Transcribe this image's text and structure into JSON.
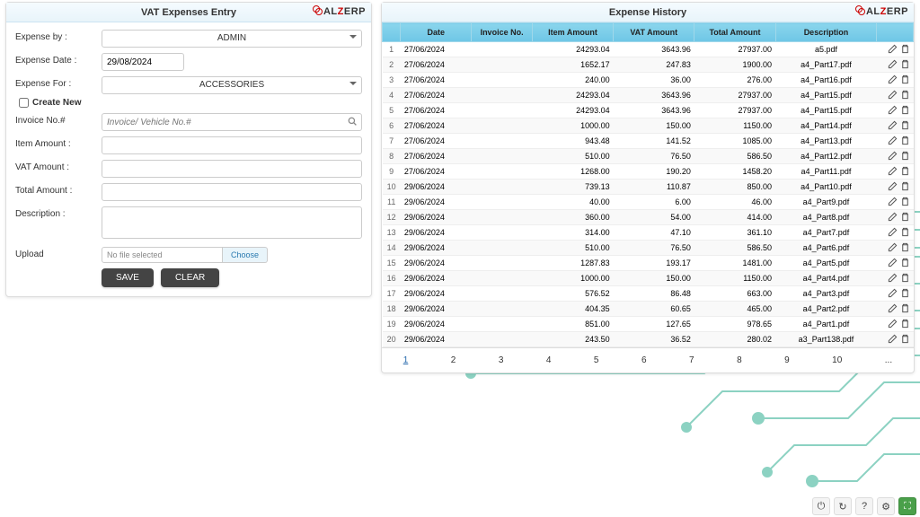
{
  "brand": "ALZERP",
  "left_panel": {
    "title": "VAT Expenses Entry",
    "labels": {
      "expense_by": "Expense by :",
      "expense_date": "Expense Date :",
      "expense_for": "Expense For :",
      "create_new": "Create New",
      "invoice_no": "Invoice No.#",
      "item_amount": "Item Amount :",
      "vat_amount": "VAT Amount :",
      "total_amount": "Total Amount :",
      "description": "Description :",
      "upload": "Upload"
    },
    "values": {
      "expense_by": "ADMIN",
      "expense_date": "29/08/2024",
      "expense_for": "ACCESSORIES",
      "invoice_placeholder": "Invoice/ Vehicle No.#",
      "file_text": "No file selected",
      "file_btn": "Choose"
    },
    "buttons": {
      "save": "SAVE",
      "clear": "CLEAR"
    }
  },
  "right_panel": {
    "title": "Expense History",
    "columns": [
      "Date",
      "Invoice No.",
      "Item Amount",
      "VAT Amount",
      "Total Amount",
      "Description"
    ],
    "rows": [
      {
        "n": "1",
        "date": "27/06/2024",
        "inv": "",
        "item": "24293.04",
        "vat": "3643.96",
        "tot": "27937.00",
        "desc": "a5.pdf"
      },
      {
        "n": "2",
        "date": "27/06/2024",
        "inv": "",
        "item": "1652.17",
        "vat": "247.83",
        "tot": "1900.00",
        "desc": "a4_Part17.pdf"
      },
      {
        "n": "3",
        "date": "27/06/2024",
        "inv": "",
        "item": "240.00",
        "vat": "36.00",
        "tot": "276.00",
        "desc": "a4_Part16.pdf"
      },
      {
        "n": "4",
        "date": "27/06/2024",
        "inv": "",
        "item": "24293.04",
        "vat": "3643.96",
        "tot": "27937.00",
        "desc": "a4_Part15.pdf"
      },
      {
        "n": "5",
        "date": "27/06/2024",
        "inv": "",
        "item": "24293.04",
        "vat": "3643.96",
        "tot": "27937.00",
        "desc": "a4_Part15.pdf"
      },
      {
        "n": "6",
        "date": "27/06/2024",
        "inv": "",
        "item": "1000.00",
        "vat": "150.00",
        "tot": "1150.00",
        "desc": "a4_Part14.pdf"
      },
      {
        "n": "7",
        "date": "27/06/2024",
        "inv": "",
        "item": "943.48",
        "vat": "141.52",
        "tot": "1085.00",
        "desc": "a4_Part13.pdf"
      },
      {
        "n": "8",
        "date": "27/06/2024",
        "inv": "",
        "item": "510.00",
        "vat": "76.50",
        "tot": "586.50",
        "desc": "a4_Part12.pdf"
      },
      {
        "n": "9",
        "date": "27/06/2024",
        "inv": "",
        "item": "1268.00",
        "vat": "190.20",
        "tot": "1458.20",
        "desc": "a4_Part11.pdf"
      },
      {
        "n": "10",
        "date": "29/06/2024",
        "inv": "",
        "item": "739.13",
        "vat": "110.87",
        "tot": "850.00",
        "desc": "a4_Part10.pdf"
      },
      {
        "n": "11",
        "date": "29/06/2024",
        "inv": "",
        "item": "40.00",
        "vat": "6.00",
        "tot": "46.00",
        "desc": "a4_Part9.pdf"
      },
      {
        "n": "12",
        "date": "29/06/2024",
        "inv": "",
        "item": "360.00",
        "vat": "54.00",
        "tot": "414.00",
        "desc": "a4_Part8.pdf"
      },
      {
        "n": "13",
        "date": "29/06/2024",
        "inv": "",
        "item": "314.00",
        "vat": "47.10",
        "tot": "361.10",
        "desc": "a4_Part7.pdf"
      },
      {
        "n": "14",
        "date": "29/06/2024",
        "inv": "",
        "item": "510.00",
        "vat": "76.50",
        "tot": "586.50",
        "desc": "a4_Part6.pdf"
      },
      {
        "n": "15",
        "date": "29/06/2024",
        "inv": "",
        "item": "1287.83",
        "vat": "193.17",
        "tot": "1481.00",
        "desc": "a4_Part5.pdf"
      },
      {
        "n": "16",
        "date": "29/06/2024",
        "inv": "",
        "item": "1000.00",
        "vat": "150.00",
        "tot": "1150.00",
        "desc": "a4_Part4.pdf"
      },
      {
        "n": "17",
        "date": "29/06/2024",
        "inv": "",
        "item": "576.52",
        "vat": "86.48",
        "tot": "663.00",
        "desc": "a4_Part3.pdf"
      },
      {
        "n": "18",
        "date": "29/06/2024",
        "inv": "",
        "item": "404.35",
        "vat": "60.65",
        "tot": "465.00",
        "desc": "a4_Part2.pdf"
      },
      {
        "n": "19",
        "date": "29/06/2024",
        "inv": "",
        "item": "851.00",
        "vat": "127.65",
        "tot": "978.65",
        "desc": "a4_Part1.pdf"
      },
      {
        "n": "20",
        "date": "29/06/2024",
        "inv": "",
        "item": "243.50",
        "vat": "36.52",
        "tot": "280.02",
        "desc": "a3_Part138.pdf"
      }
    ],
    "pages": [
      "1",
      "2",
      "3",
      "4",
      "5",
      "6",
      "7",
      "8",
      "9",
      "10",
      "..."
    ],
    "active_page": "1"
  }
}
